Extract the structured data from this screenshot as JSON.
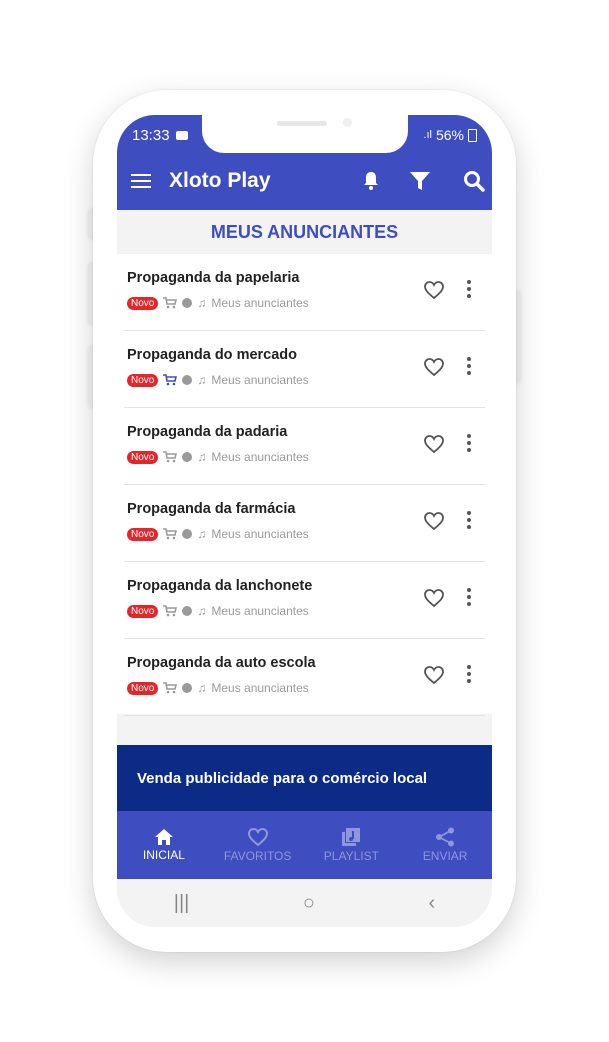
{
  "status": {
    "time": "13:33",
    "battery": "56%"
  },
  "appbar": {
    "title": "Xloto Play"
  },
  "section": {
    "title": "MEUS ANUNCIANTES"
  },
  "items": [
    {
      "title": "Propaganda da papelaria",
      "badge": "Novo",
      "category": "Meus anunciantes"
    },
    {
      "title": "Propaganda do mercado",
      "badge": "Novo",
      "category": "Meus anunciantes"
    },
    {
      "title": "Propaganda da padaria",
      "badge": "Novo",
      "category": "Meus anunciantes"
    },
    {
      "title": "Propaganda da farmácia",
      "badge": "Novo",
      "category": "Meus anunciantes"
    },
    {
      "title": "Propaganda da lanchonete",
      "badge": "Novo",
      "category": "Meus anunciantes"
    },
    {
      "title": "Propaganda da auto escola",
      "badge": "Novo",
      "category": "Meus anunciantes"
    }
  ],
  "banner": {
    "text": "Venda publicidade para o comércio local"
  },
  "bottom_nav": [
    {
      "label": "INICIAL",
      "icon": "home-icon",
      "active": true
    },
    {
      "label": "FAVORITOS",
      "icon": "heart-icon",
      "active": false
    },
    {
      "label": "PLAYLIST",
      "icon": "playlist-icon",
      "active": false
    },
    {
      "label": "ENVIAR",
      "icon": "share-icon",
      "active": false
    }
  ],
  "system_nav": {
    "recents": "|||",
    "home": "○",
    "back": "‹"
  },
  "colors": {
    "primary": "#3e4dbf",
    "banner": "#0b2b86",
    "badge": "#e3262a"
  }
}
